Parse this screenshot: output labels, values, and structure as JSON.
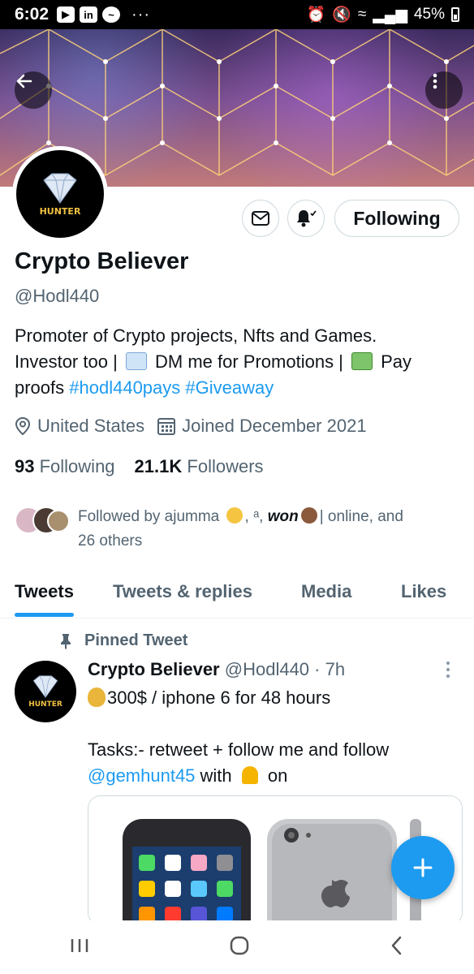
{
  "status_bar": {
    "time": "6:02",
    "app_icons": [
      "play-icon",
      "linkedin-icon",
      "messenger-icon"
    ],
    "more": "···",
    "battery": "45%"
  },
  "profile": {
    "avatar_text": "HUNTER",
    "display_name": "Crypto Believer",
    "handle": "@Hodl440",
    "following_button": "Following",
    "bio": {
      "line1": "Promoter of Crypto projects, Nfts and Games.",
      "line2_a": "Investor too | ",
      "line2_b": " DM me for Promotions | ",
      "line2_c": " Pay",
      "line3_a": "proofs ",
      "hashtag1": "#hodl440pays",
      "hashtag2": "#Giveaway"
    },
    "location": "United States",
    "joined": "Joined December 2021",
    "following_count": "93",
    "following_label": "Following",
    "followers_count": "21.1K",
    "followers_label": "Followers",
    "followed_by": {
      "prefix": "Followed by ajumma",
      "mid": ", ᵃ, ",
      "name_won": "won",
      "suffix": "| online, and",
      "line2": "26 others"
    }
  },
  "tabs": [
    "Tweets",
    "Tweets & replies",
    "Media",
    "Likes"
  ],
  "tweet": {
    "pinned_label": "Pinned Tweet",
    "avatar_text": "HUNTER",
    "author": "Crypto Believer",
    "handle_time": "@Hodl440 · 7h",
    "line1": "300$ / iphone 6 for 48 hours",
    "line2": "Tasks:- retweet + follow me and follow",
    "mention": "@gemhunt45",
    "line3_mid": " with ",
    "line3_end": " on"
  },
  "colors": {
    "accent": "#1d9bf0",
    "text": "#0f1419",
    "secondary": "#536471"
  }
}
